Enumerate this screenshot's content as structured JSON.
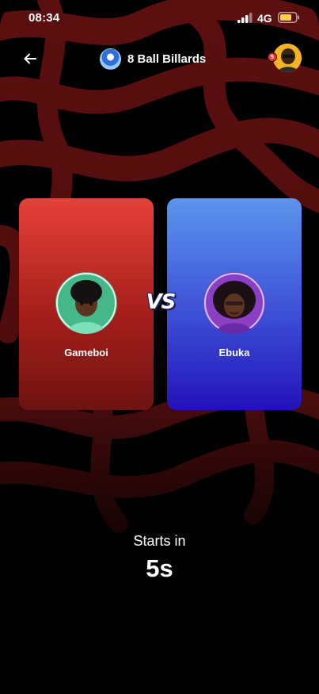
{
  "status_bar": {
    "time": "08:34",
    "network": "4G",
    "icons": [
      "signal-bars-icon",
      "battery-icon"
    ]
  },
  "header": {
    "back_icon": "arrow-left-icon",
    "game_title": "8 Ball Billards",
    "notification_count": "5"
  },
  "match": {
    "player_one": {
      "name": "Gameboi",
      "card_color": "#d9362f"
    },
    "player_two": {
      "name": "Ebuka",
      "card_color": "#4a6fe3"
    },
    "versus_label": "VS"
  },
  "countdown": {
    "label": "Starts in",
    "value": "5s"
  },
  "colors": {
    "background": "#000000",
    "stripe": "#5a0e0e",
    "red_card": "#e5423a",
    "blue_card": "#5b95ee"
  }
}
